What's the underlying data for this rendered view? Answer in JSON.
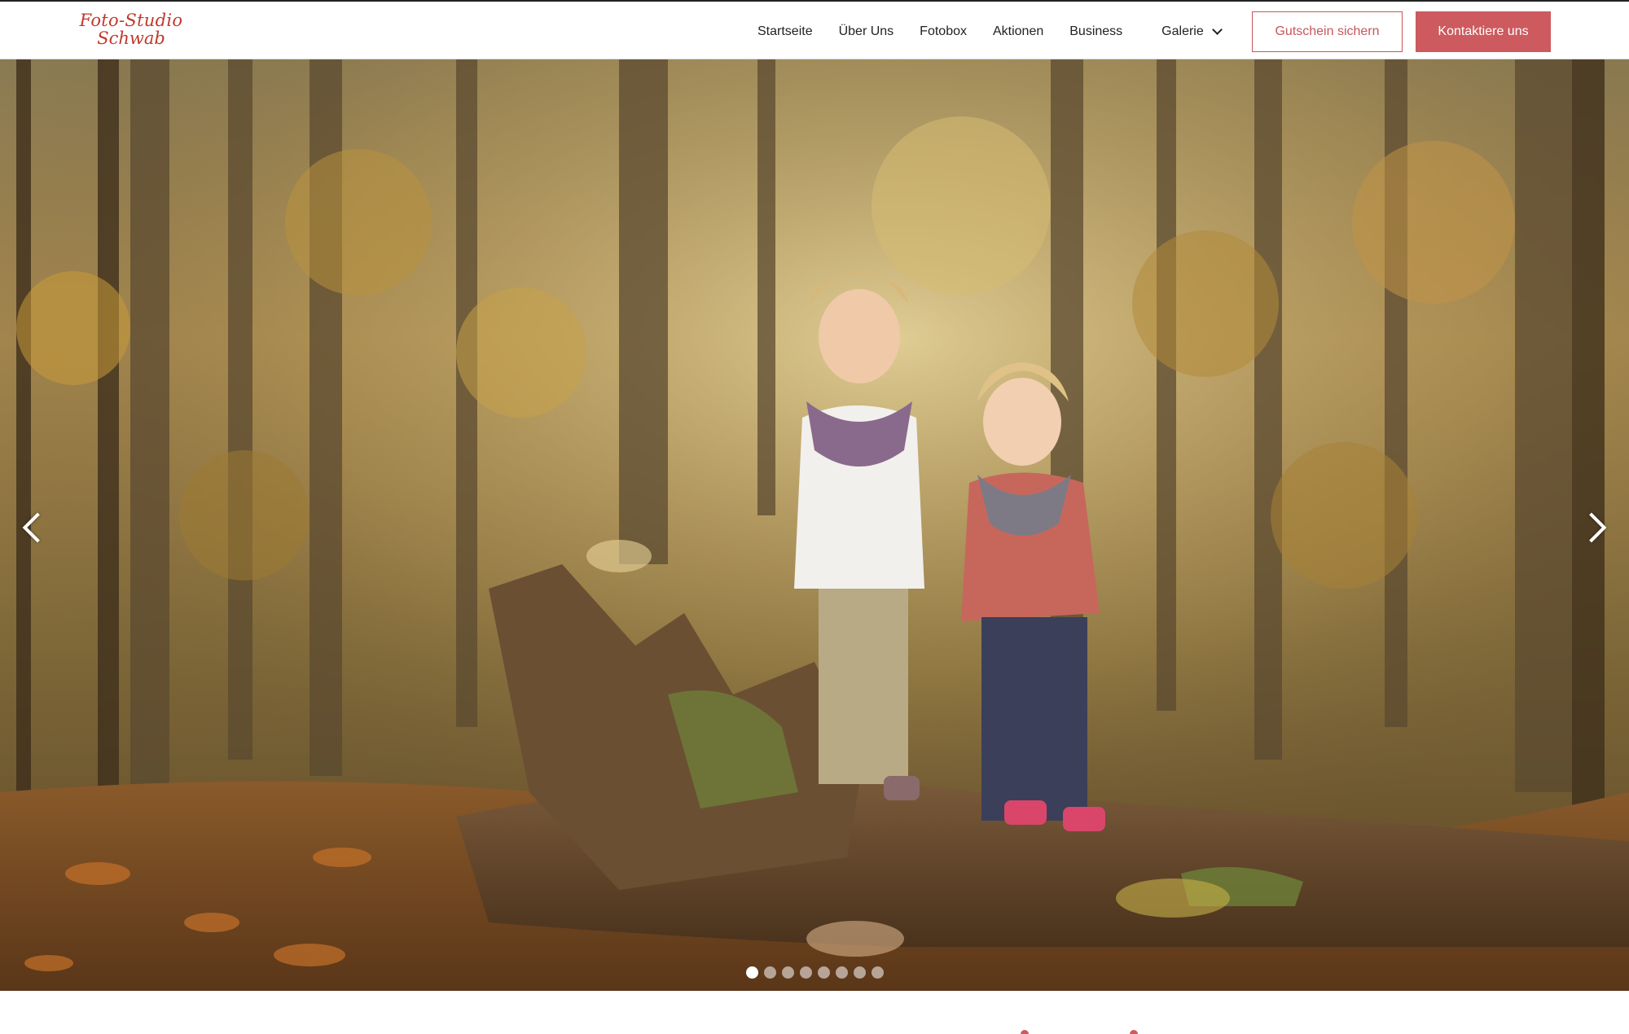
{
  "logo": {
    "line1": "Foto-Studio",
    "line2": "Schwab"
  },
  "nav": {
    "items": [
      "Startseite",
      "Über Uns",
      "Fotobox",
      "Aktionen",
      "Business"
    ],
    "galerie_label": "Galerie"
  },
  "buttons": {
    "voucher_label": "Gutschein sichern",
    "contact_label": "Kontaktiere uns"
  },
  "colors": {
    "accent": "#cc5a5e",
    "logo": "#c0392b"
  },
  "slider": {
    "slide_count": 8,
    "active_index": 0
  }
}
